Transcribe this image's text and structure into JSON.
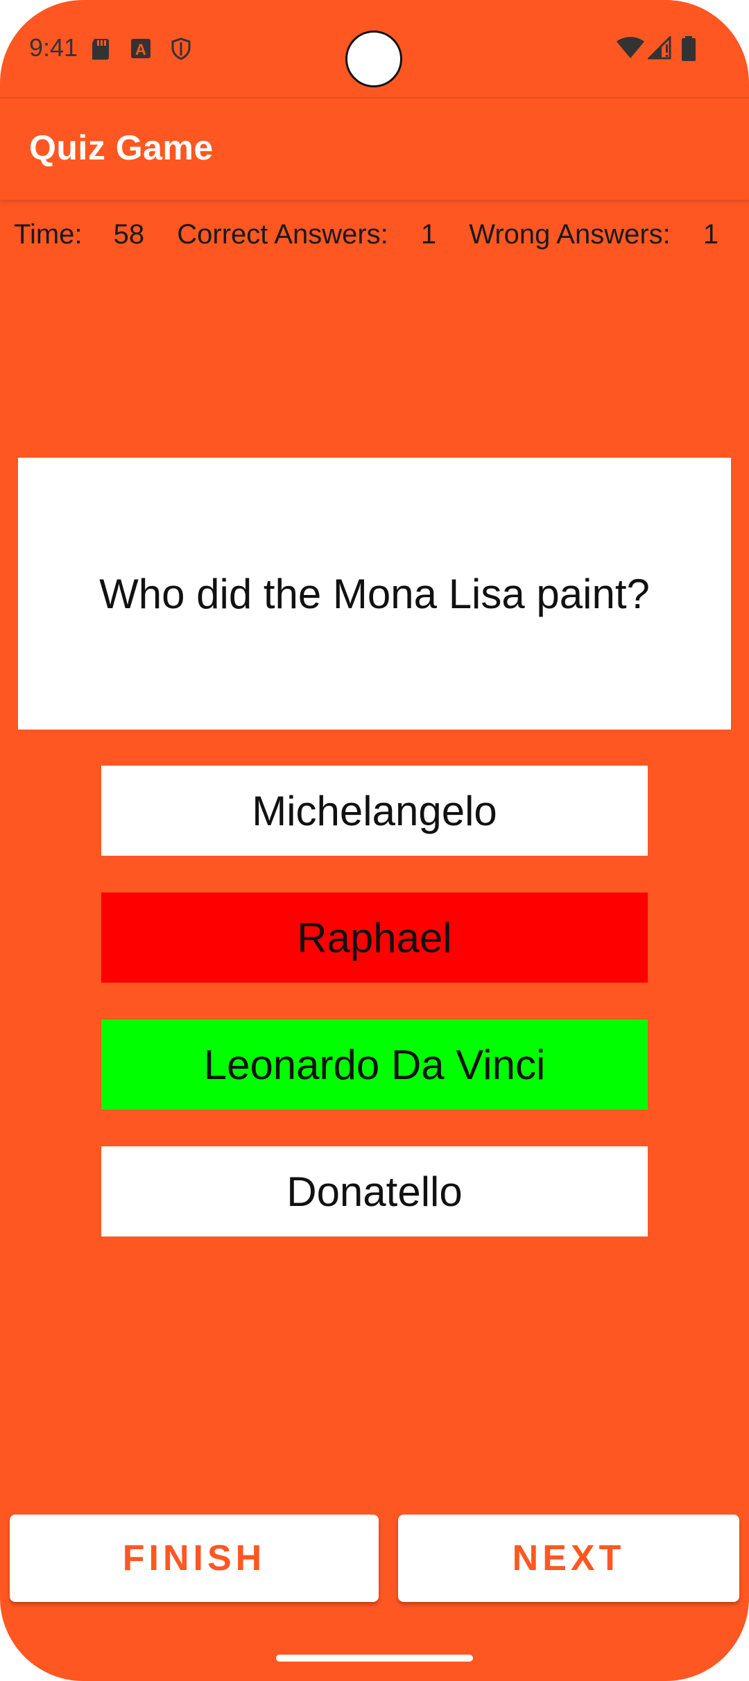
{
  "status_bar": {
    "time": "9:41",
    "left_icons": [
      "sd-card-icon",
      "a-badge-icon",
      "shield-icon"
    ],
    "right_icons": [
      "wifi-icon",
      "signal-icon",
      "battery-icon"
    ]
  },
  "app_bar": {
    "title": "Quiz Game"
  },
  "stats": {
    "time_label": "Time:",
    "time_value": "58",
    "correct_label": "Correct Answers:",
    "correct_value": "1",
    "wrong_label": "Wrong Answers:",
    "wrong_value": "1"
  },
  "question": {
    "text": "Who did the Mona Lisa paint?"
  },
  "answers": [
    {
      "label": "Michelangelo",
      "state": "default",
      "color": "#FFFFFF"
    },
    {
      "label": "Raphael",
      "state": "wrong",
      "color": "#FF0000"
    },
    {
      "label": "Leonardo Da Vinci",
      "state": "correct",
      "color": "#00FF00"
    },
    {
      "label": "Donatello",
      "state": "default",
      "color": "#FFFFFF"
    }
  ],
  "buttons": {
    "finish": "FINISH",
    "next": "NEXT"
  },
  "colors": {
    "background": "#FF5722",
    "accent_text": "#FF5722",
    "card": "#FFFFFF"
  }
}
